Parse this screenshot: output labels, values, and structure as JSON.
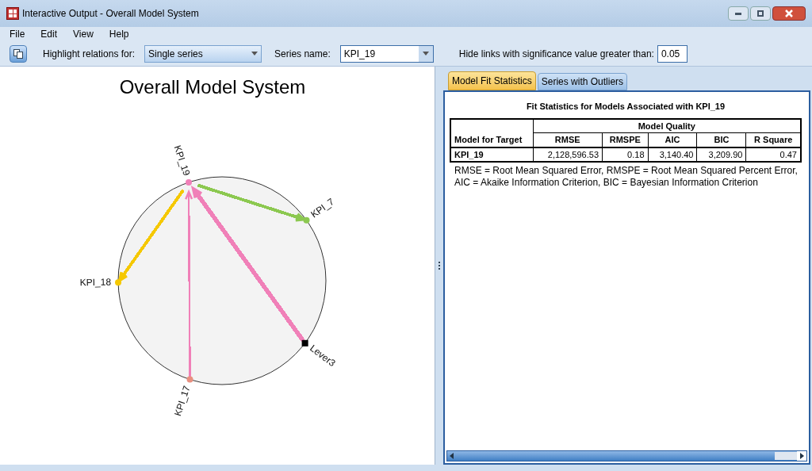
{
  "window": {
    "title": "Interactive Output - Overall Model System"
  },
  "menu": [
    "File",
    "Edit",
    "View",
    "Help"
  ],
  "toolbar": {
    "highlight_label": "Highlight relations for:",
    "highlight_value": "Single series",
    "series_label": "Series name:",
    "series_value": "KPI_19",
    "hide_label": "Hide links with significance value greater than:",
    "hide_value": "0.05"
  },
  "graph": {
    "title": "Overall Model System",
    "nodes": [
      {
        "label": "KPI_19",
        "color": "#f080b8"
      },
      {
        "label": "KPI_7",
        "color": "#8cc850",
        "link": {
          "incoming": false,
          "color": "#8cc850",
          "kind": "medium"
        }
      },
      {
        "label": "Lever3",
        "color": "#000000",
        "link": {
          "incoming": true,
          "color": "#f080b8",
          "kind": "thick"
        }
      },
      {
        "label": "KPI_17",
        "color": "#e89080",
        "link": {
          "incoming": true,
          "color": "#f080b8",
          "kind": "thin"
        }
      },
      {
        "label": "KPI_18",
        "color": "#f5c800",
        "link": {
          "incoming": false,
          "color": "#f5c800",
          "kind": "medium"
        }
      }
    ]
  },
  "tabs": [
    {
      "label": "Model Fit Statistics",
      "selected": true
    },
    {
      "label": "Series with Outliers",
      "selected": false
    }
  ],
  "table": {
    "title": "Fit Statistics for Models Associated with KPI_19",
    "row_header": "Model for Target",
    "group_header": "Model Quality",
    "columns": [
      "RMSE",
      "RMSPE",
      "AIC",
      "BIC",
      "R Square"
    ],
    "rows": [
      {
        "target": "KPI_19",
        "values": [
          "2,128,596.53",
          "0.18",
          "3,140.40",
          "3,209.90",
          "0.47"
        ]
      }
    ],
    "footnotes": [
      "RMSE = Root Mean Squared Error, RMSPE = Root Mean Squared Percent Error,",
      "AIC = Akaike Information Criterion, BIC = Bayesian Information Criterion"
    ]
  }
}
